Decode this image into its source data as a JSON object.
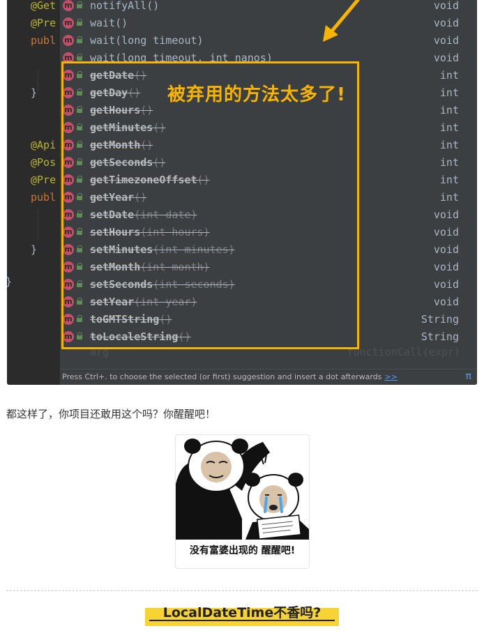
{
  "ide": {
    "code_lines": [
      {
        "text": "@Get",
        "kind": "ann"
      },
      {
        "text": "@Pre",
        "kind": "ann"
      },
      {
        "text": "publ",
        "kind": "kw"
      },
      {
        "text": "}",
        "kind": "plain"
      },
      {
        "text": "@Api",
        "kind": "ann"
      },
      {
        "text": "@Pos",
        "kind": "ann"
      },
      {
        "text": "@Pre",
        "kind": "ann"
      },
      {
        "text": "publ",
        "kind": "kw"
      },
      {
        "text": "}",
        "kind": "plain"
      }
    ],
    "outer_brace": "}",
    "right_edge_char": "g"
  },
  "completion": {
    "items": [
      {
        "method": "notifyAll",
        "args": "()",
        "type": "void",
        "deprecated": false
      },
      {
        "method": "wait",
        "args": "()",
        "type": "void",
        "deprecated": false
      },
      {
        "method": "wait",
        "args": "(long timeout)",
        "type": "void",
        "deprecated": false
      },
      {
        "method": "wait",
        "args": "(long timeout, int nanos)",
        "type": "void",
        "deprecated": false
      },
      {
        "method": "getDate",
        "args": "()",
        "type": "int",
        "deprecated": true
      },
      {
        "method": "getDay",
        "args": "()",
        "type": "int",
        "deprecated": true
      },
      {
        "method": "getHours",
        "args": "()",
        "type": "int",
        "deprecated": true
      },
      {
        "method": "getMinutes",
        "args": "()",
        "type": "int",
        "deprecated": true
      },
      {
        "method": "getMonth",
        "args": "()",
        "type": "int",
        "deprecated": true
      },
      {
        "method": "getSeconds",
        "args": "()",
        "type": "int",
        "deprecated": true
      },
      {
        "method": "getTimezoneOffset",
        "args": "()",
        "type": "int",
        "deprecated": true
      },
      {
        "method": "getYear",
        "args": "()",
        "type": "int",
        "deprecated": true
      },
      {
        "method": "setDate",
        "args": "(int date)",
        "type": "void",
        "deprecated": true
      },
      {
        "method": "setHours",
        "args": "(int hours)",
        "type": "void",
        "deprecated": true
      },
      {
        "method": "setMinutes",
        "args": "(int minutes)",
        "type": "void",
        "deprecated": true
      },
      {
        "method": "setMonth",
        "args": "(int month)",
        "type": "void",
        "deprecated": true
      },
      {
        "method": "setSeconds",
        "args": "(int seconds)",
        "type": "void",
        "deprecated": true
      },
      {
        "method": "setYear",
        "args": "(int year)",
        "type": "void",
        "deprecated": true
      },
      {
        "method": "toGMTString",
        "args": "()",
        "type": "String",
        "deprecated": true
      },
      {
        "method": "toLocaleString",
        "args": "()",
        "type": "String",
        "deprecated": true
      }
    ],
    "faded_row": {
      "left": "arg",
      "right": "functionCall(expr)"
    },
    "icon_letter": "m",
    "footer_hint": "Press Ctrl+. to choose the selected (or first) suggestion and insert a dot afterwards",
    "footer_link": ">>",
    "footer_icon": "π"
  },
  "annotation": {
    "callout": "被弃用的方法太多了!",
    "accent_color": "#f7b500"
  },
  "article": {
    "paragraph": "都这样了，你项目还敢用这个吗？你醒醒吧！",
    "meme_caption": "没有富婆出现的 醒醒吧!",
    "section_heading": "LocalDateTime不香吗?",
    "heading_highlight_color": "#f7d333"
  }
}
